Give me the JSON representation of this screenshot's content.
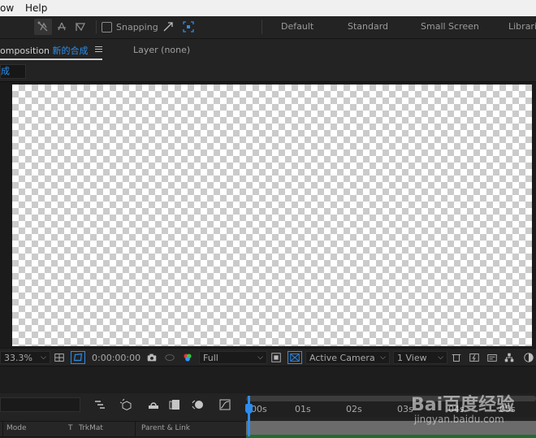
{
  "menubar": {
    "items": [
      "ow",
      "Help"
    ]
  },
  "toolbar": {
    "snapping_label": "Snapping",
    "workspaces": [
      "Default",
      "Standard",
      "Small Screen",
      "Librari"
    ]
  },
  "panel": {
    "comp_tab_prefix": "omposition",
    "comp_name": "新的合成",
    "layer_tab": "Layer (none)",
    "flowchart_tag": "成"
  },
  "footer": {
    "magnification": "33.3%",
    "timecode": "0:00:00:00",
    "resolution": "Full",
    "camera": "Active Camera",
    "views": "1 View"
  },
  "timeline": {
    "ticks": [
      "00s",
      "01s",
      "02s",
      "03s",
      "04s",
      "05s"
    ],
    "columns": {
      "mode": "Mode",
      "t": "T",
      "trkmat": "TrkMat",
      "parent": "Parent & Link"
    }
  },
  "watermark": {
    "logo": "Bai百度经验",
    "url": "jingyan.baidu.com"
  },
  "colors": {
    "accent": "#2d8ceb",
    "checker": "#cbcbcb",
    "work_area": "#1f6e2f"
  }
}
